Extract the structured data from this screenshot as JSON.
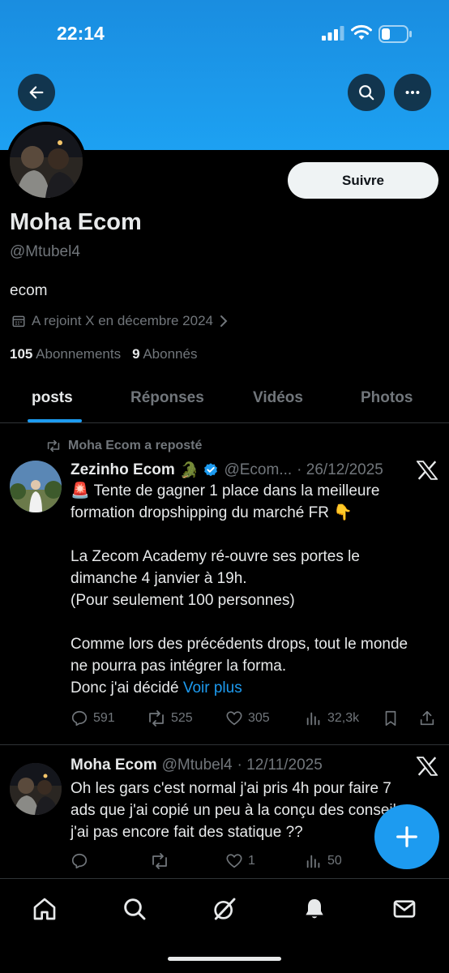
{
  "status_bar": {
    "time": "22:14"
  },
  "profile": {
    "name": "Moha Ecom",
    "handle": "@Mtubel4",
    "bio": "ecom",
    "joined": "A rejoint X en décembre 2024",
    "following_count": "105",
    "following_label": "Abonnements",
    "followers_count": "9",
    "followers_label": "Abonnés",
    "follow_label": "Suivre"
  },
  "tabs": [
    {
      "label": "posts",
      "active": true
    },
    {
      "label": "Réponses",
      "active": false
    },
    {
      "label": "Vidéos",
      "active": false
    },
    {
      "label": "Photos",
      "active": false
    }
  ],
  "tweets": [
    {
      "repost_label": "Moha Ecom a reposté",
      "author": "Zezinho Ecom",
      "author_emoji": "🐊",
      "verified": true,
      "handle": "@Ecom...",
      "date": "· 26/12/2025",
      "text": "🚨 Tente de gagner 1 place dans la meilleure formation dropshipping du marché FR 👇\n\nLa Zecom Academy ré-ouvre ses portes le dimanche 4 janvier à 19h.\n(Pour seulement 100 personnes)\n\nComme lors des précédents drops, tout le monde ne pourra pas intégrer la forma.\nDonc j'ai décidé ",
      "more_label": "Voir plus",
      "replies": "591",
      "reposts": "525",
      "likes": "305",
      "views": "32,3k"
    },
    {
      "author": "Moha Ecom",
      "handle": "@Mtubel4",
      "date": "· 12/11/2025",
      "text": "Oh les gars c'est normal j'ai pris 4h pour faire 7 ads que j'ai copié un peu à la conçu des conseils j'ai pas encore fait des statique ??",
      "replies": "",
      "reposts": "",
      "likes": "1",
      "views": "50"
    }
  ],
  "colors": {
    "accent": "#1d9bf0",
    "banner": "#1da1f2",
    "muted": "#71767b",
    "text": "#e7e9ea"
  },
  "icons": {
    "back": "arrow-left-icon",
    "search": "search-icon",
    "more": "more-icon",
    "nav": [
      "home-icon",
      "search-icon",
      "grok-icon",
      "bell-icon",
      "mail-icon"
    ],
    "compose": "plus-icon"
  }
}
